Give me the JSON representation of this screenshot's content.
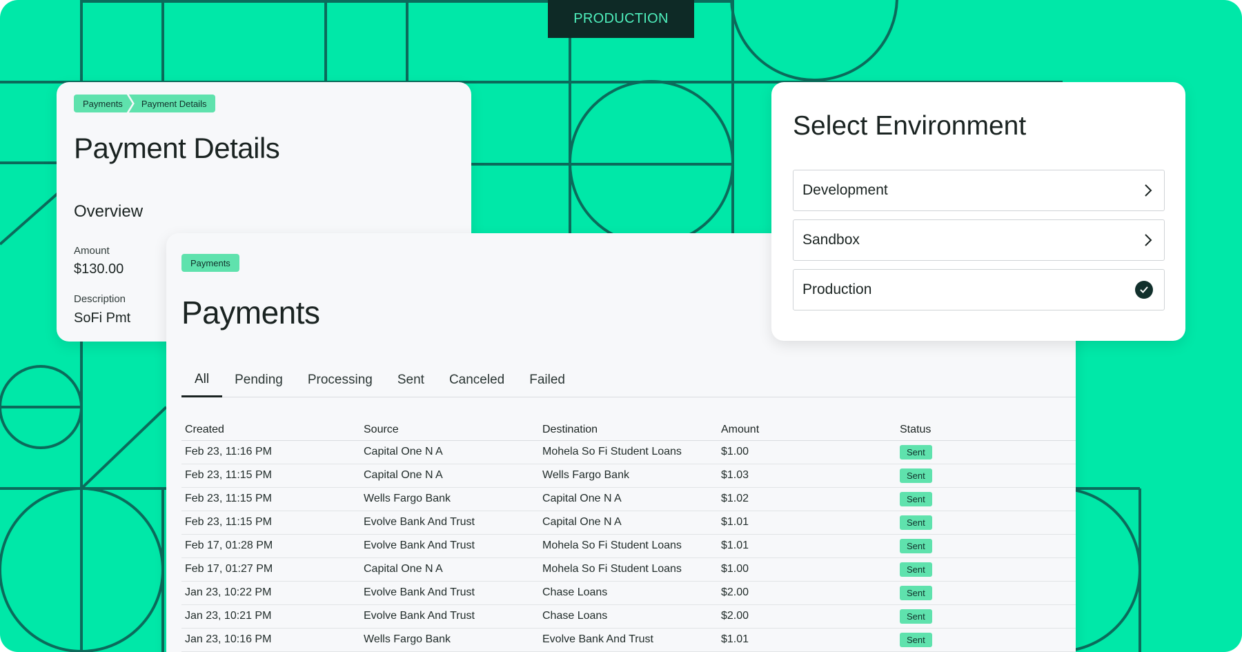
{
  "env_tag": "PRODUCTION",
  "details": {
    "breadcrumb": [
      "Payments",
      "Payment Details"
    ],
    "title": "Payment Details",
    "section": "Overview",
    "amount_label": "Amount",
    "amount_value": "$130.00",
    "description_label": "Description",
    "description_value": "SoFi Pmt"
  },
  "payments": {
    "tag": "Payments",
    "title": "Payments",
    "tabs": [
      "All",
      "Pending",
      "Processing",
      "Sent",
      "Canceled",
      "Failed"
    ],
    "active_tab": "All",
    "columns": [
      "Created",
      "Source",
      "Destination",
      "Amount",
      "Status"
    ],
    "rows": [
      [
        "Feb 23, 11:16 PM",
        "Capital One N A",
        "Mohela So Fi Student Loans",
        "$1.00",
        "Sent"
      ],
      [
        "Feb 23, 11:15 PM",
        "Capital One N A",
        "Wells Fargo Bank",
        "$1.03",
        "Sent"
      ],
      [
        "Feb 23, 11:15 PM",
        "Wells Fargo Bank",
        "Capital One N A",
        "$1.02",
        "Sent"
      ],
      [
        "Feb 23, 11:15 PM",
        "Evolve Bank And Trust",
        "Capital One N A",
        "$1.01",
        "Sent"
      ],
      [
        "Feb 17, 01:28 PM",
        "Evolve Bank And Trust",
        "Mohela So Fi Student Loans",
        "$1.01",
        "Sent"
      ],
      [
        "Feb 17, 01:27 PM",
        "Capital One N A",
        "Mohela So Fi Student Loans",
        "$1.00",
        "Sent"
      ],
      [
        "Jan 23, 10:22 PM",
        "Evolve Bank And Trust",
        "Chase Loans",
        "$2.00",
        "Sent"
      ],
      [
        "Jan 23, 10:21 PM",
        "Evolve Bank And Trust",
        "Chase Loans",
        "$2.00",
        "Sent"
      ],
      [
        "Jan 23, 10:16 PM",
        "Wells Fargo Bank",
        "Evolve Bank And Trust",
        "$1.01",
        "Sent"
      ]
    ]
  },
  "environment": {
    "title": "Select Environment",
    "options": [
      {
        "label": "Development",
        "icon": "chevron-right-icon",
        "selected": false
      },
      {
        "label": "Sandbox",
        "icon": "chevron-right-icon",
        "selected": false
      },
      {
        "label": "Production",
        "icon": "check-circle-icon",
        "selected": true
      }
    ]
  },
  "colors": {
    "background": "#00e8a8",
    "line": "#0b6b5b",
    "accent_pill": "#5fe2ad",
    "dark": "#0e2a26"
  }
}
